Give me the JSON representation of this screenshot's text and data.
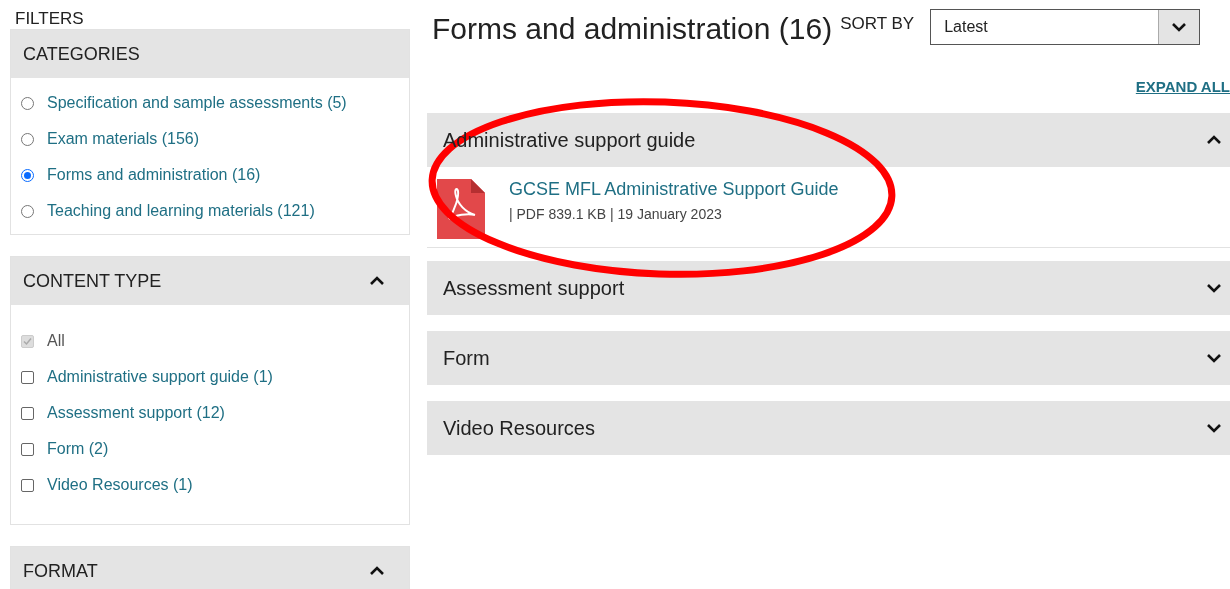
{
  "filters_title": "FILTERS",
  "categories": {
    "title": "CATEGORIES",
    "items": [
      {
        "label": "Specification and sample assessments (5)",
        "selected": false
      },
      {
        "label": "Exam materials (156)",
        "selected": false
      },
      {
        "label": "Forms and administration (16)",
        "selected": true
      },
      {
        "label": "Teaching and learning materials (121)",
        "selected": false
      }
    ]
  },
  "content_type": {
    "title": "CONTENT TYPE",
    "expanded": true,
    "items": [
      {
        "label": "All",
        "checked": true,
        "disabled": true
      },
      {
        "label": "Administrative support guide (1)",
        "checked": false,
        "disabled": false
      },
      {
        "label": "Assessment support (12)",
        "checked": false,
        "disabled": false
      },
      {
        "label": "Form (2)",
        "checked": false,
        "disabled": false
      },
      {
        "label": "Video Resources (1)",
        "checked": false,
        "disabled": false
      }
    ]
  },
  "format": {
    "title": "FORMAT",
    "expanded": true
  },
  "heading": "Forms and administration (16)",
  "sort": {
    "label": "SORT BY",
    "value": "Latest"
  },
  "expand_all": "EXPAND ALL",
  "sections": [
    {
      "title": "Administrative support guide",
      "expanded": true,
      "documents": [
        {
          "title": "GCSE MFL Administrative Support Guide",
          "meta": "| PDF 839.1 KB | 19 January 2023"
        }
      ]
    },
    {
      "title": "Assessment support",
      "expanded": false
    },
    {
      "title": "Form",
      "expanded": false
    },
    {
      "title": "Video Resources",
      "expanded": false
    }
  ],
  "annotation": {
    "kind": "ellipse"
  }
}
